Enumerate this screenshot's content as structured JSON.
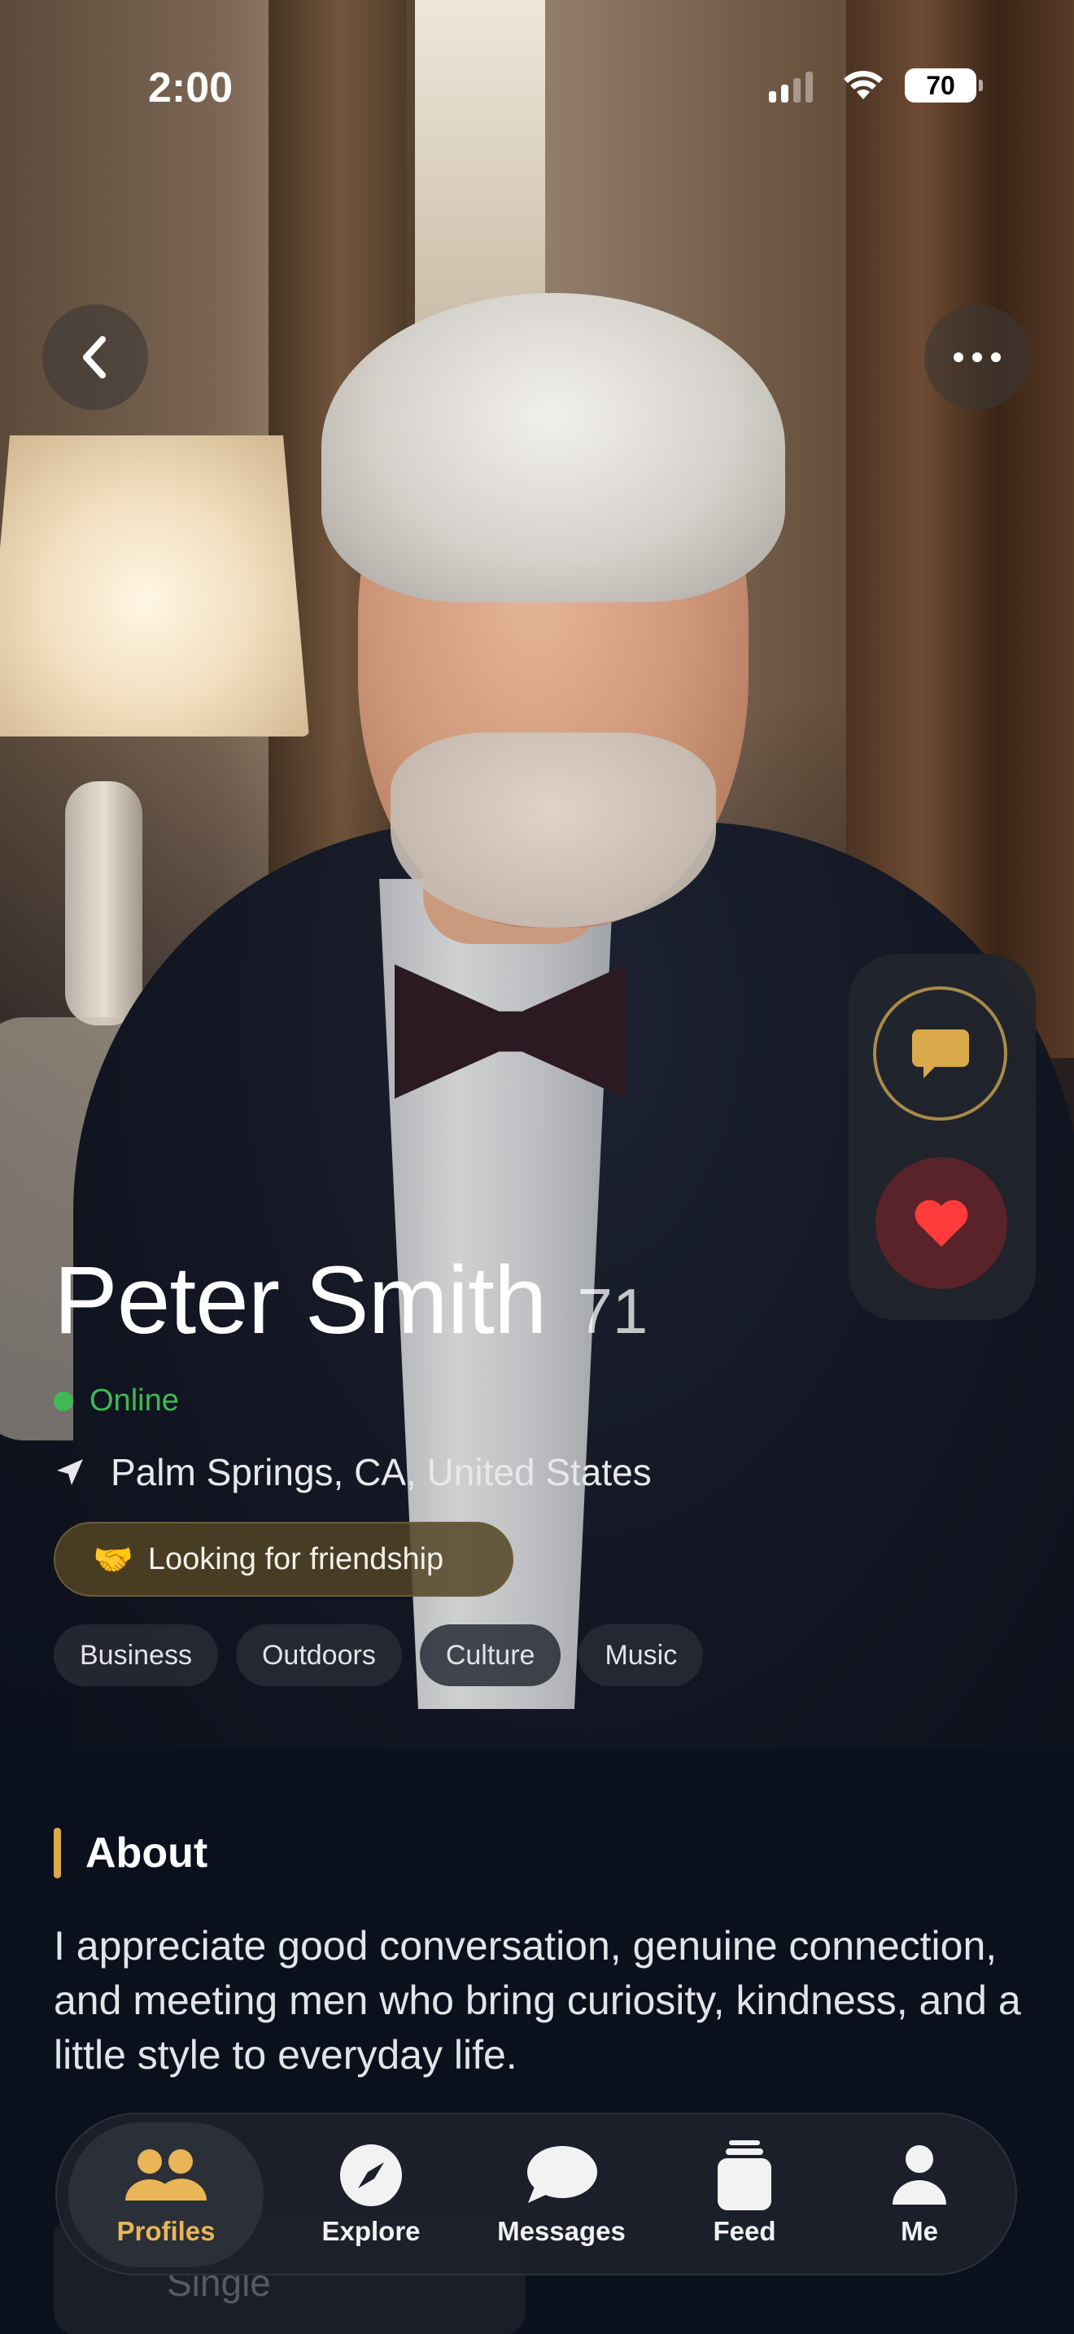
{
  "status_bar": {
    "time": "2:00",
    "battery": "70"
  },
  "profile": {
    "name": "Peter Smith",
    "age": "71",
    "status": "Online",
    "location": "Palm Springs, CA, United States",
    "intent": {
      "emoji": "🤝",
      "label": "Looking for friendship"
    },
    "tags": [
      "Business",
      "Outdoors",
      "Culture",
      "Music"
    ]
  },
  "about": {
    "title": "About",
    "text": "I appreciate good conversation, genuine connection, and meeting men who bring curiosity, kindness, and a little style to everyday life."
  },
  "details": {
    "relationship": "Single"
  },
  "tabs": [
    {
      "label": "Profiles",
      "icon": "people-icon",
      "active": true
    },
    {
      "label": "Explore",
      "icon": "compass-icon",
      "active": false
    },
    {
      "label": "Messages",
      "icon": "chat-bubble-icon",
      "active": false
    },
    {
      "label": "Feed",
      "icon": "feed-jar-icon",
      "active": false
    },
    {
      "label": "Me",
      "icon": "person-icon",
      "active": false
    }
  ],
  "colors": {
    "accent": "#e9b556",
    "online": "#3fb953",
    "like": "#ff3b3b",
    "background": "#0b101d"
  }
}
